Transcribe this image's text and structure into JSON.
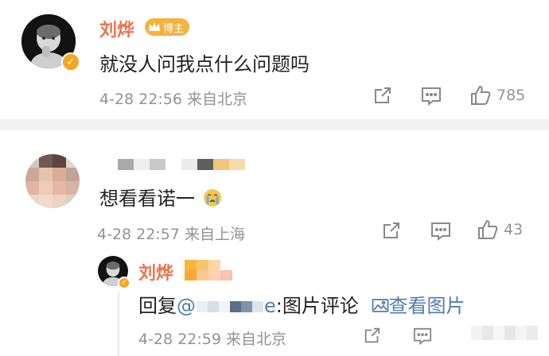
{
  "comments": [
    {
      "author": "刘烨",
      "badge": "博主",
      "text": "就没人问我点什么问题吗",
      "meta": "4-28 22:56 来自北京",
      "likes": "785"
    },
    {
      "author": "",
      "text": "想看看诺一",
      "emoji": "crying-face",
      "meta": "4-28 22:57 来自上海",
      "likes": "43"
    }
  ],
  "reply": {
    "author": "刘烨",
    "prefix": "回复",
    "mention_visible": "@",
    "mention_tail": "e",
    "suffix": ":图片评论",
    "link_label": "查看图片",
    "meta": "4-28 22:59 来自北京"
  },
  "icons": [
    "share-icon",
    "comment-icon",
    "like-icon",
    "picture-icon",
    "verified-icon",
    "crown-icon"
  ],
  "colors": {
    "accent": "#eb7350",
    "link": "#507daf",
    "meta": "#939393",
    "badge": "#f4b23e"
  }
}
